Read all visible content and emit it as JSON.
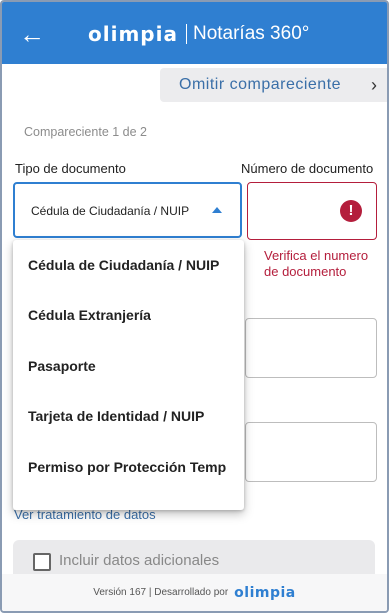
{
  "header": {
    "back_icon": "arrow-left-icon",
    "brand": "olimpia",
    "title": "Notarías 360°"
  },
  "skip": {
    "label": "Omitir compareciente",
    "icon": "chevron-right-icon"
  },
  "form": {
    "step": "Compareciente 1 de 2",
    "doc_type_label": "Tipo de documento",
    "doc_type_value": "Cédula de Ciudadanía / NUIP",
    "doc_number_label": "Número de documento",
    "doc_number_error": "Verifica el numero de documento",
    "privacy_link": "Ver tratamiento de datos",
    "additional_label": "Incluir datos adicionales"
  },
  "dropdown": {
    "options": [
      "Cédula de Ciudadanía / NUIP",
      "Cédula Extranjería",
      "Pasaporte",
      "Tarjeta de Identidad / NUIP",
      "Permiso por Protección Temp"
    ]
  },
  "footer": {
    "text": "Versión 167 | Desarrollado por",
    "brand": "olimpia"
  },
  "colors": {
    "primary": "#2f7fd1",
    "error": "#b41e3c",
    "link": "#3a6fa8"
  }
}
